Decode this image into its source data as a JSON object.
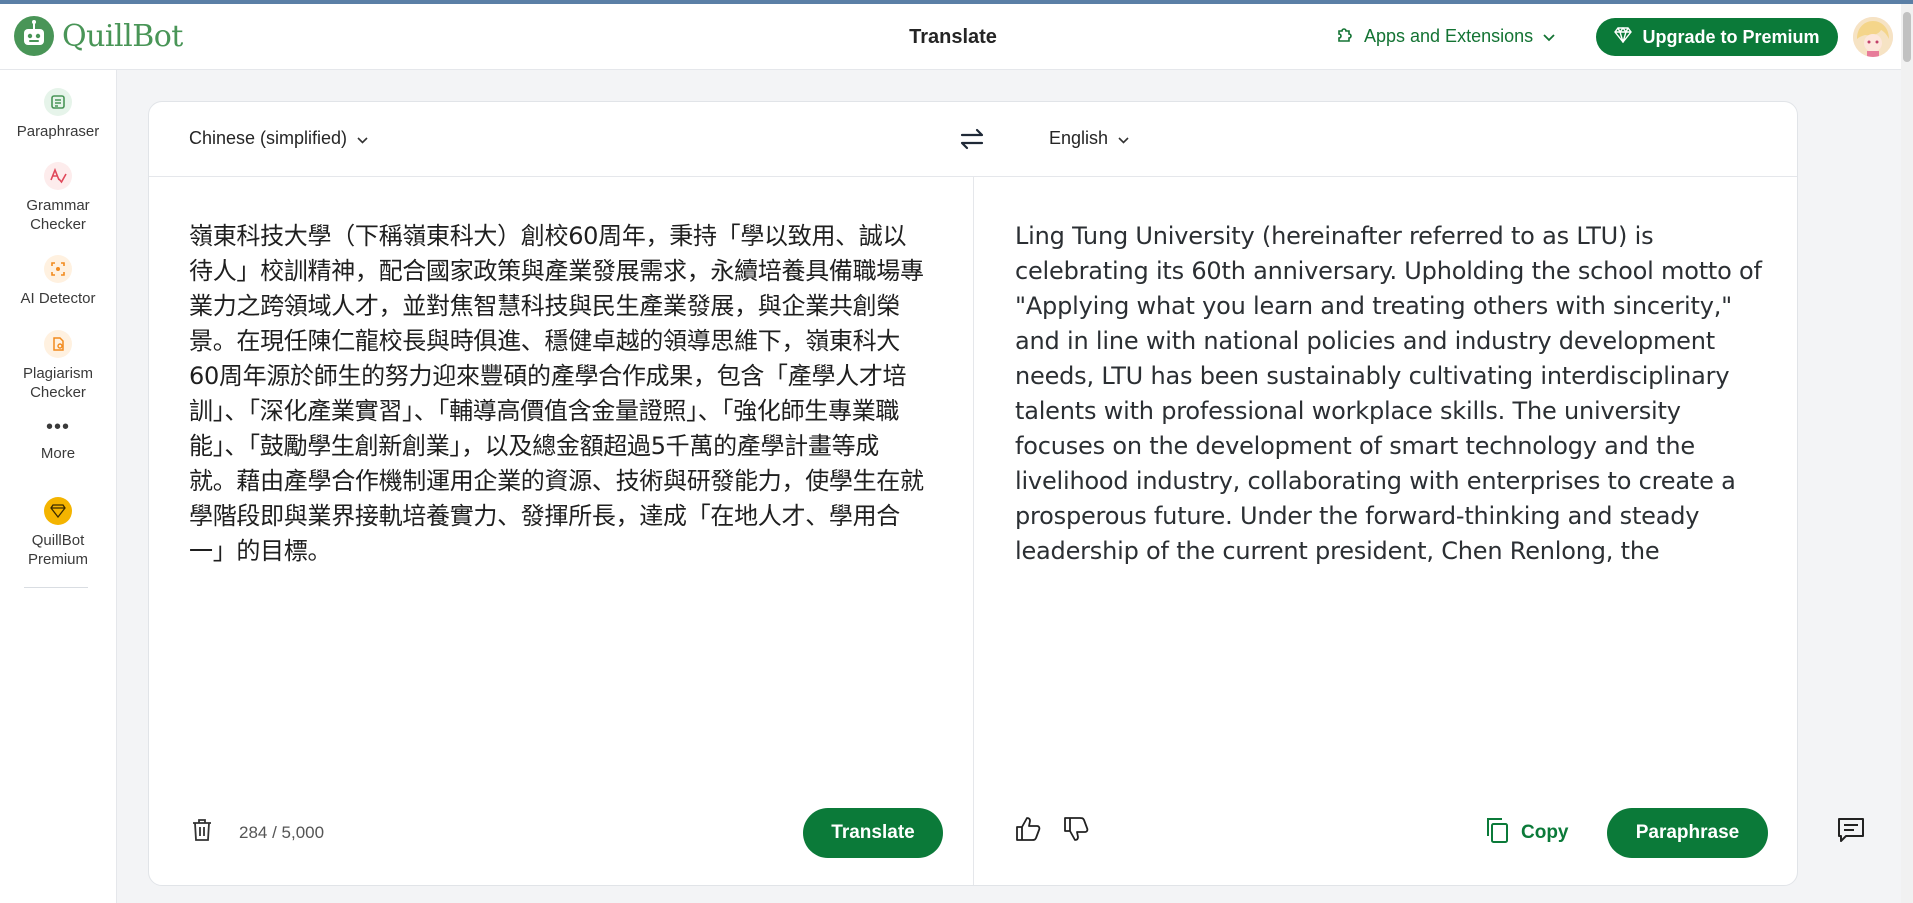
{
  "brand": {
    "name": "QuillBot"
  },
  "header": {
    "title": "Translate",
    "apps_label": "Apps and Extensions",
    "upgrade_label": "Upgrade to Premium"
  },
  "sidebar": {
    "items": [
      {
        "label": "Paraphraser",
        "icon": "paraphraser-icon"
      },
      {
        "label": "Grammar Checker",
        "icon": "grammar-checker-icon"
      },
      {
        "label": "AI Detector",
        "icon": "ai-detector-icon"
      },
      {
        "label": "Plagiarism Checker",
        "icon": "plagiarism-checker-icon"
      },
      {
        "label": "More",
        "icon": "more-dots-icon"
      },
      {
        "label": "QuillBot Premium",
        "icon": "premium-gem-icon"
      }
    ]
  },
  "translator": {
    "source_language": "Chinese (simplified)",
    "target_language": "English",
    "source_text": "嶺東科技大學（下稱嶺東科大）創校60周年，秉持「學以致用、誠以待人」校訓精神，配合國家政策與產業發展需求，永續培養具備職場專業力之跨領域人才，並對焦智慧科技與民生產業發展，與企業共創榮景。在現任陳仁龍校長與時俱進、穩健卓越的領導思維下，嶺東科大60周年源於師生的努力迎來豐碩的產學合作成果，包含「產學人才培訓」、「深化產業實習」、「輔導高價值含金量證照」、「強化師生專業職能」、「鼓勵學生創新創業」，以及總金額超過5千萬的產學計畫等成就。藉由產學合作機制運用企業的資源、技術與研發能力，使學生在就學階段即與業界接軌培養實力、發揮所長，達成「在地人才、學用合一」的目標。",
    "target_text": "Ling Tung University (hereinafter referred to as LTU) is celebrating its 60th anniversary. Upholding the school motto of \"Applying what you learn and treating others with sincerity,\" and in line with national policies and industry development needs, LTU has been sustainably cultivating interdisciplinary talents with professional workplace skills. The university focuses on the development of smart technology and the livelihood industry, collaborating with enterprises to create a prosperous future. Under the forward-thinking and steady leadership of the current president, Chen Renlong, the",
    "char_count": "284 / 5,000",
    "translate_label": "Translate",
    "copy_label": "Copy",
    "paraphrase_label": "Paraphrase"
  },
  "colors": {
    "brand_green": "#499557",
    "button_green": "#0b7a39",
    "link_green": "#137333"
  }
}
